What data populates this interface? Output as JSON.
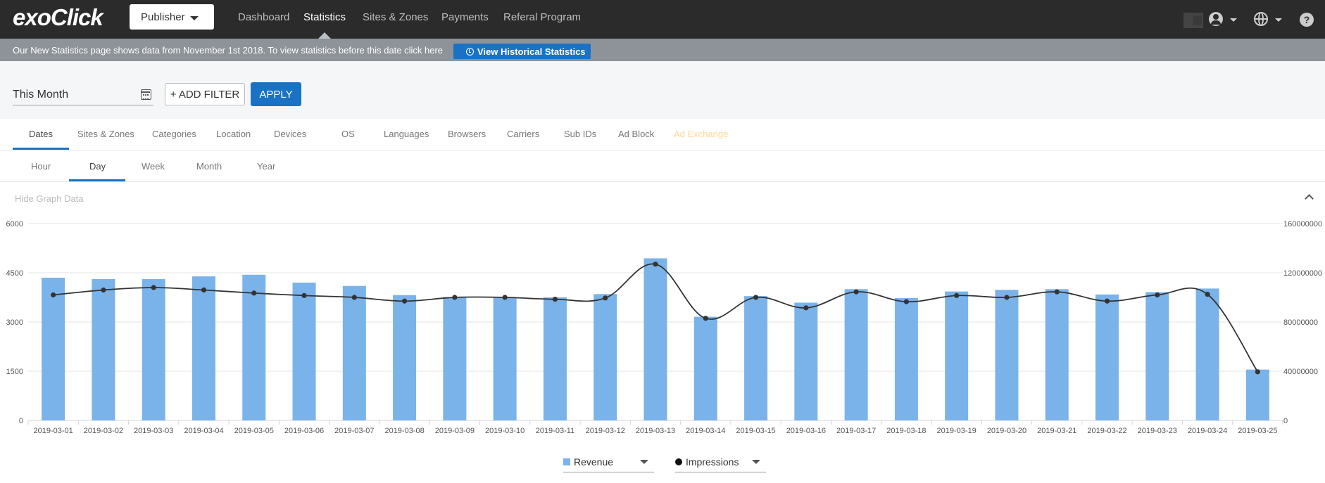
{
  "brand": {
    "logo": "exoClick"
  },
  "header": {
    "account_type": "Publisher",
    "nav": [
      "Dashboard",
      "Statistics",
      "Sites & Zones",
      "Payments",
      "Referal Program"
    ],
    "help": "?"
  },
  "notice": {
    "text": "Our New Statistics page shows data from November 1st 2018. To view statistics before this date click here",
    "button": "View Historical Statistics"
  },
  "filters": {
    "date_range": "This Month",
    "add_filter": "ADD FILTER",
    "add_prefix": "+",
    "apply": "APPLY"
  },
  "dimension_tabs": [
    "Dates",
    "Sites & Zones",
    "Categories",
    "Location",
    "Devices",
    "OS",
    "Languages",
    "Browsers",
    "Carriers",
    "Sub IDs",
    "Ad Block",
    "Ad Exchange"
  ],
  "period_tabs": [
    "Hour",
    "Day",
    "Week",
    "Month",
    "Year"
  ],
  "graph_toggle": "Hide Graph Data",
  "chart_data": {
    "type": "bar",
    "categories": [
      "2019-03-01",
      "2019-03-02",
      "2019-03-03",
      "2019-03-04",
      "2019-03-05",
      "2019-03-06",
      "2019-03-07",
      "2019-03-08",
      "2019-03-09",
      "2019-03-10",
      "2019-03-11",
      "2019-03-12",
      "2019-03-13",
      "2019-03-14",
      "2019-03-15",
      "2019-03-16",
      "2019-03-17",
      "2019-03-18",
      "2019-03-19",
      "2019-03-20",
      "2019-03-21",
      "2019-03-22",
      "2019-03-23",
      "2019-03-24",
      "2019-03-25"
    ],
    "series": [
      {
        "name": "Revenue",
        "type": "bar",
        "axis": "left",
        "color": "#7ab3ea",
        "values": [
          4350,
          4310,
          4310,
          4390,
          4440,
          4200,
          4100,
          3820,
          3760,
          3760,
          3750,
          3850,
          4940,
          3160,
          3790,
          3590,
          4000,
          3730,
          3930,
          3980,
          4000,
          3840,
          3910,
          4020,
          1550
        ]
      },
      {
        "name": "Impressions",
        "type": "line",
        "axis": "right",
        "color": "#333333",
        "values": [
          102000000,
          106000000,
          108000000,
          106000000,
          103500000,
          101500000,
          100000000,
          97000000,
          100000000,
          100000000,
          98500000,
          99500000,
          127000000,
          83000000,
          100000000,
          91500000,
          104500000,
          96500000,
          101500000,
          100000000,
          104500000,
          97000000,
          102000000,
          102500000,
          39500000
        ]
      }
    ],
    "yaxis_left": {
      "ylim": [
        0,
        6000
      ],
      "ticks": [
        "0",
        "1500",
        "3000",
        "4500",
        "6000"
      ]
    },
    "yaxis_right": {
      "ylim": [
        0,
        160000000
      ],
      "ticks": [
        "0",
        "40000000",
        "80000000",
        "120000000",
        "160000000"
      ]
    },
    "title": "",
    "xlabel": "",
    "ylabel": "",
    "grid": true,
    "legend_position": "bottom-center"
  },
  "legend": [
    {
      "label": "Revenue"
    },
    {
      "label": "Impressions"
    }
  ]
}
